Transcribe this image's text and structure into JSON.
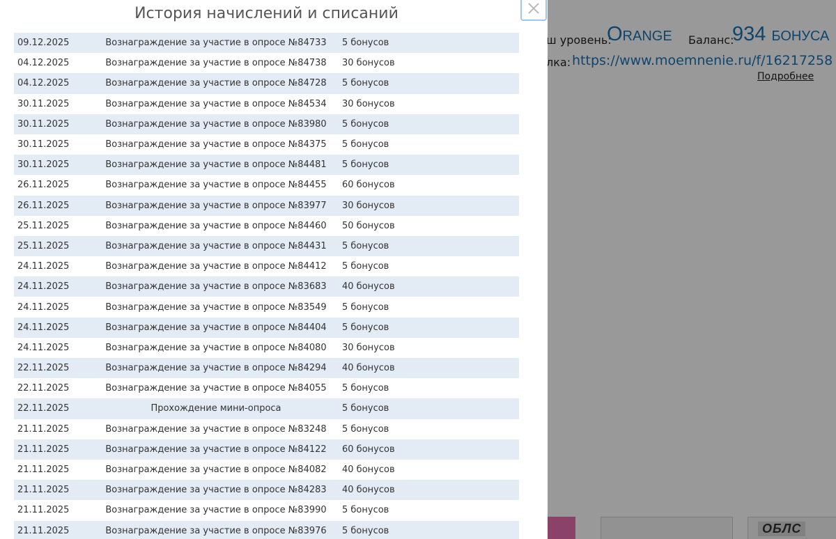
{
  "background": {
    "level_label": "ш уровень:",
    "level_value": "Orange",
    "balance_label": "Баланс:",
    "balance_value": "934 бонуса",
    "ref_label": "лка:",
    "ref_link": "https://www.moemnenie.ru/f/16217258",
    "more_link": "Подробнее",
    "tile_text": "ОБЛС"
  },
  "modal": {
    "title": "История начислений и списаний",
    "close_icon": "close-icon",
    "rows": [
      {
        "date": "09.12.2025",
        "description": "Вознаграждение за участие в опросе №84733",
        "amount": "5 бонусов"
      },
      {
        "date": "04.12.2025",
        "description": "Вознаграждение за участие в опросе №84738",
        "amount": "30 бонусов"
      },
      {
        "date": "04.12.2025",
        "description": "Вознаграждение за участие в опросе №84728",
        "amount": "5 бонусов"
      },
      {
        "date": "30.11.2025",
        "description": "Вознаграждение за участие в опросе №84534",
        "amount": "30 бонусов"
      },
      {
        "date": "30.11.2025",
        "description": "Вознаграждение за участие в опросе №83980",
        "amount": "5 бонусов"
      },
      {
        "date": "30.11.2025",
        "description": "Вознаграждение за участие в опросе №84375",
        "amount": "5 бонусов"
      },
      {
        "date": "30.11.2025",
        "description": "Вознаграждение за участие в опросе №84481",
        "amount": "5 бонусов"
      },
      {
        "date": "26.11.2025",
        "description": "Вознаграждение за участие в опросе №84455",
        "amount": "60 бонусов"
      },
      {
        "date": "26.11.2025",
        "description": "Вознаграждение за участие в опросе №83977",
        "amount": "30 бонусов"
      },
      {
        "date": "25.11.2025",
        "description": "Вознаграждение за участие в опросе №84460",
        "amount": "50 бонусов"
      },
      {
        "date": "25.11.2025",
        "description": "Вознаграждение за участие в опросе №84431",
        "amount": "5 бонусов"
      },
      {
        "date": "24.11.2025",
        "description": "Вознаграждение за участие в опросе №84412",
        "amount": "5 бонусов"
      },
      {
        "date": "24.11.2025",
        "description": "Вознаграждение за участие в опросе №83683",
        "amount": "40 бонусов"
      },
      {
        "date": "24.11.2025",
        "description": "Вознаграждение за участие в опросе №83549",
        "amount": "5 бонусов"
      },
      {
        "date": "24.11.2025",
        "description": "Вознаграждение за участие в опросе №84404",
        "amount": "5 бонусов"
      },
      {
        "date": "24.11.2025",
        "description": "Вознаграждение за участие в опросе №84080",
        "amount": "30 бонусов"
      },
      {
        "date": "22.11.2025",
        "description": "Вознаграждение за участие в опросе №84294",
        "amount": "40 бонусов"
      },
      {
        "date": "22.11.2025",
        "description": "Вознаграждение за участие в опросе №84055",
        "amount": "5 бонусов"
      },
      {
        "date": "22.11.2025",
        "description": "Прохождение мини-опроса",
        "amount": "5 бонусов"
      },
      {
        "date": "21.11.2025",
        "description": "Вознаграждение за участие в опросе №83248",
        "amount": "5 бонусов"
      },
      {
        "date": "21.11.2025",
        "description": "Вознаграждение за участие в опросе №84122",
        "amount": "60 бонусов"
      },
      {
        "date": "21.11.2025",
        "description": "Вознаграждение за участие в опросе №84082",
        "amount": "40 бонусов"
      },
      {
        "date": "21.11.2025",
        "description": "Вознаграждение за участие в опросе №84283",
        "amount": "40 бонусов"
      },
      {
        "date": "21.11.2025",
        "description": "Вознаграждение за участие в опросе №83990",
        "amount": "5 бонусов"
      },
      {
        "date": "21.11.2025",
        "description": "Вознаграждение за участие в опросе №83976",
        "amount": "5 бонусов"
      }
    ]
  },
  "colors": {
    "accent": "#1a73b5",
    "row_stripe": "#e3ebf5",
    "close_border": "#9fc6ec"
  }
}
